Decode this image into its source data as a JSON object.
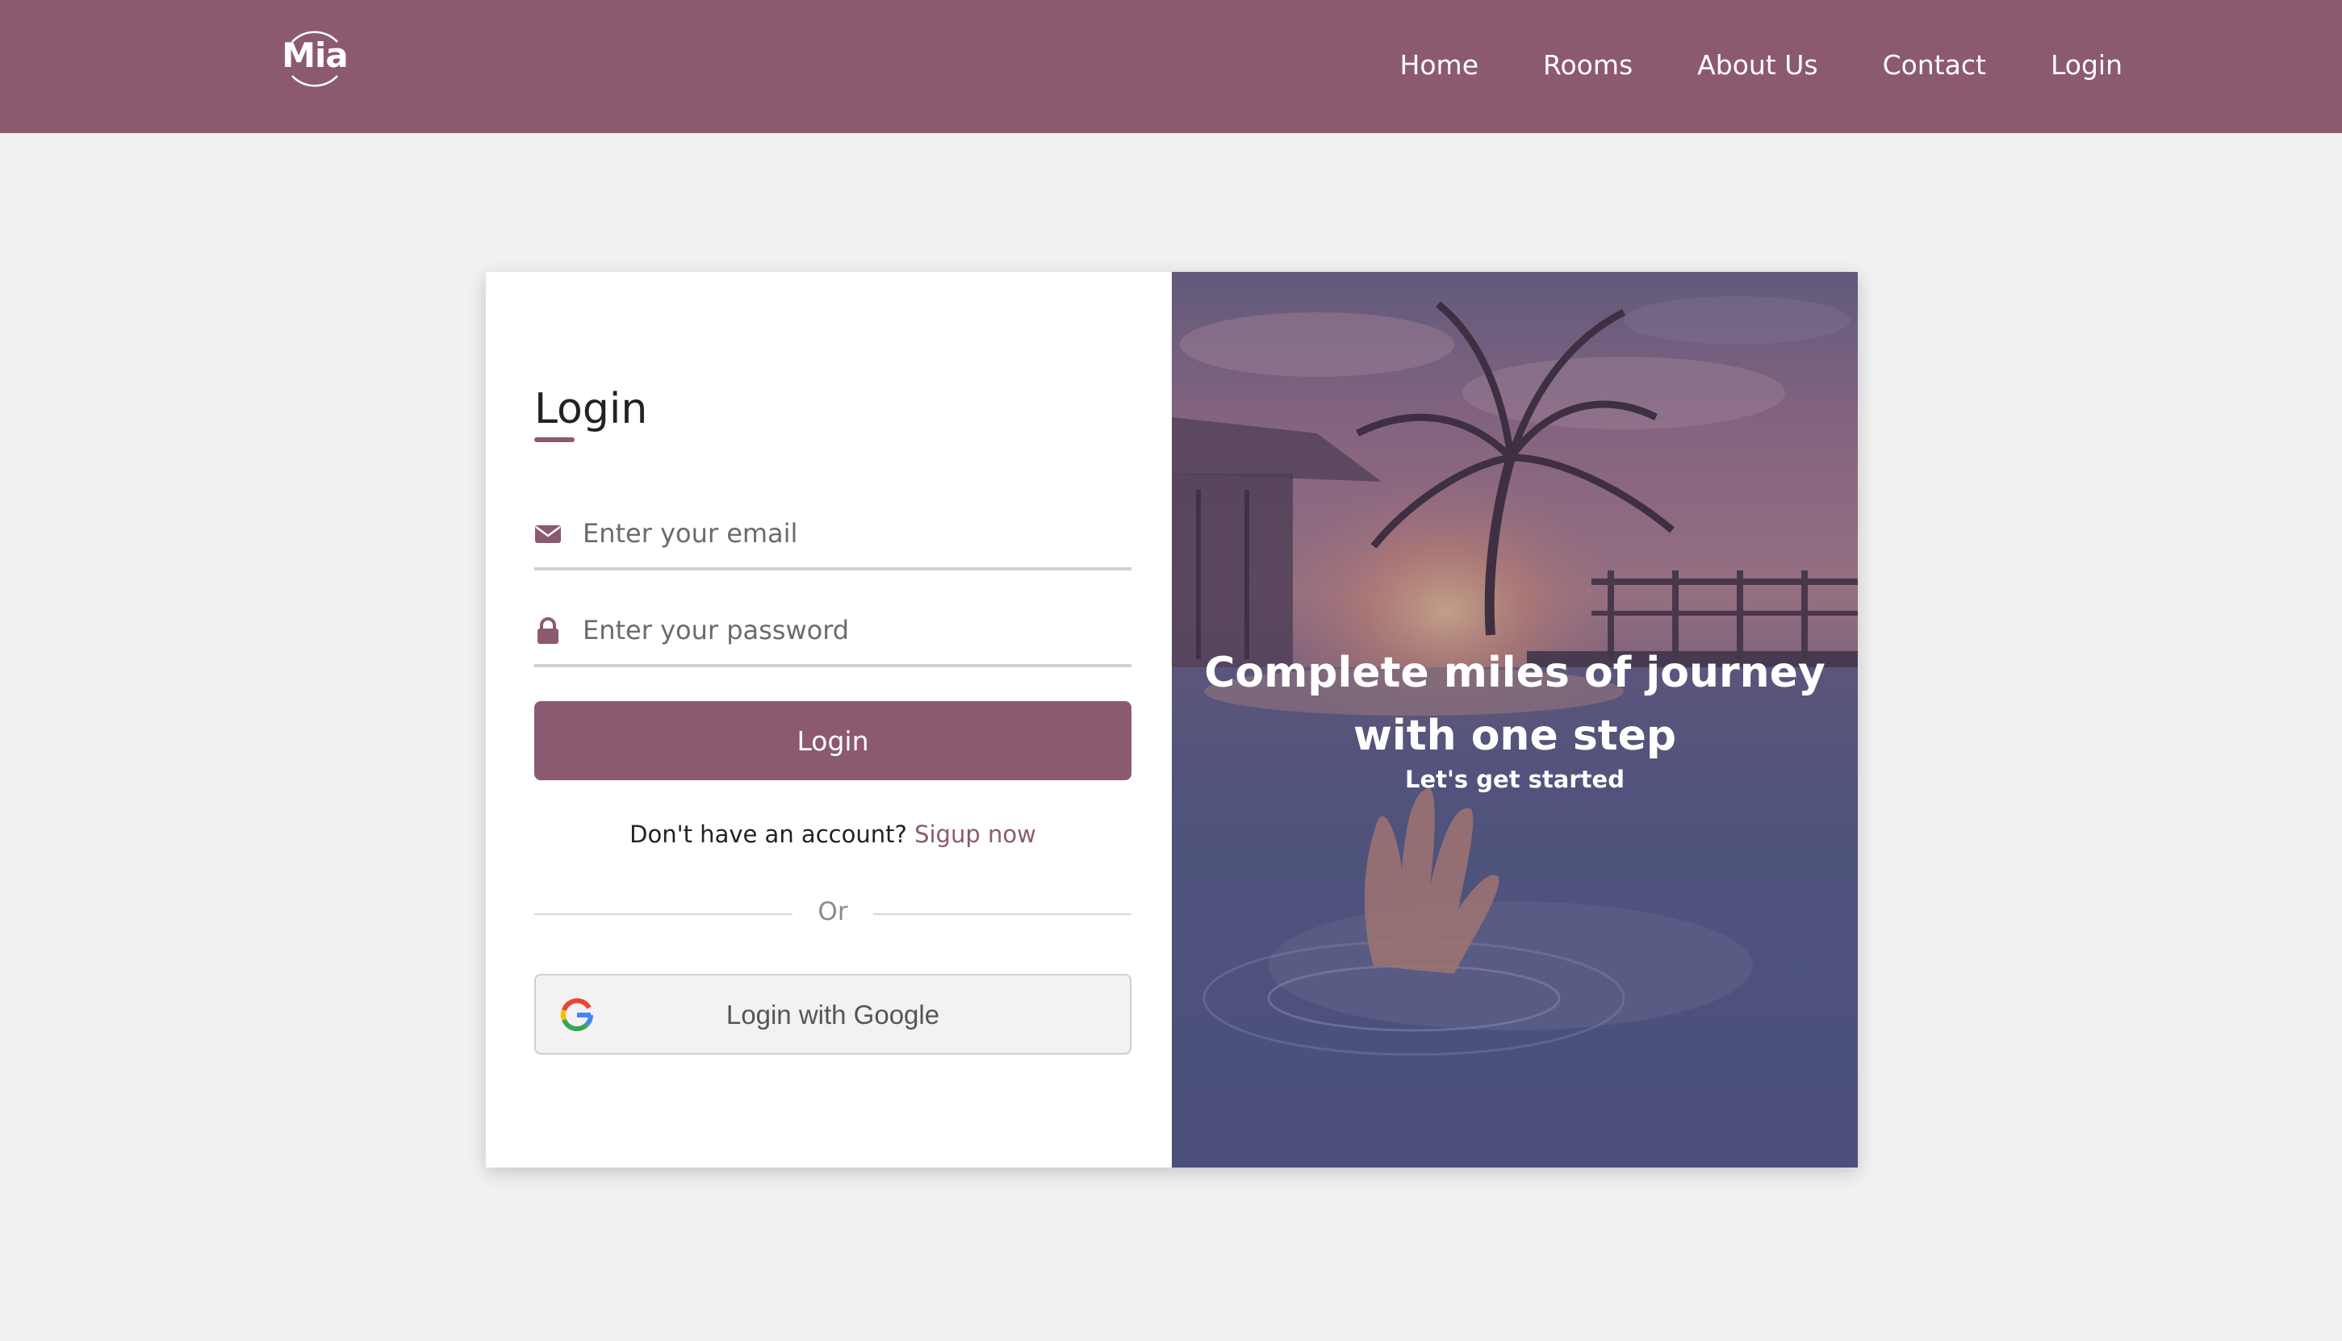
{
  "header": {
    "logo_text": "Mia",
    "nav": [
      "Home",
      "Rooms",
      "About Us",
      "Contact",
      "Login"
    ]
  },
  "login_form": {
    "title": "Login",
    "email_placeholder": "Enter your email",
    "password_placeholder": "Enter your password",
    "submit_label": "Login",
    "signup_prompt": "Don't have an account?",
    "signup_link": "Sigup now",
    "divider": "Or",
    "google_label": "Login with Google",
    "email_icon": "envelope-icon",
    "password_icon": "lock-icon",
    "google_icon": "google-icon"
  },
  "hero": {
    "heading": "Complete miles of journey with one step",
    "subheading": "Let's get started"
  },
  "colors": {
    "brand": "#8c5a70",
    "page_background": "#f1f1f1",
    "card_background": "#ffffff"
  }
}
